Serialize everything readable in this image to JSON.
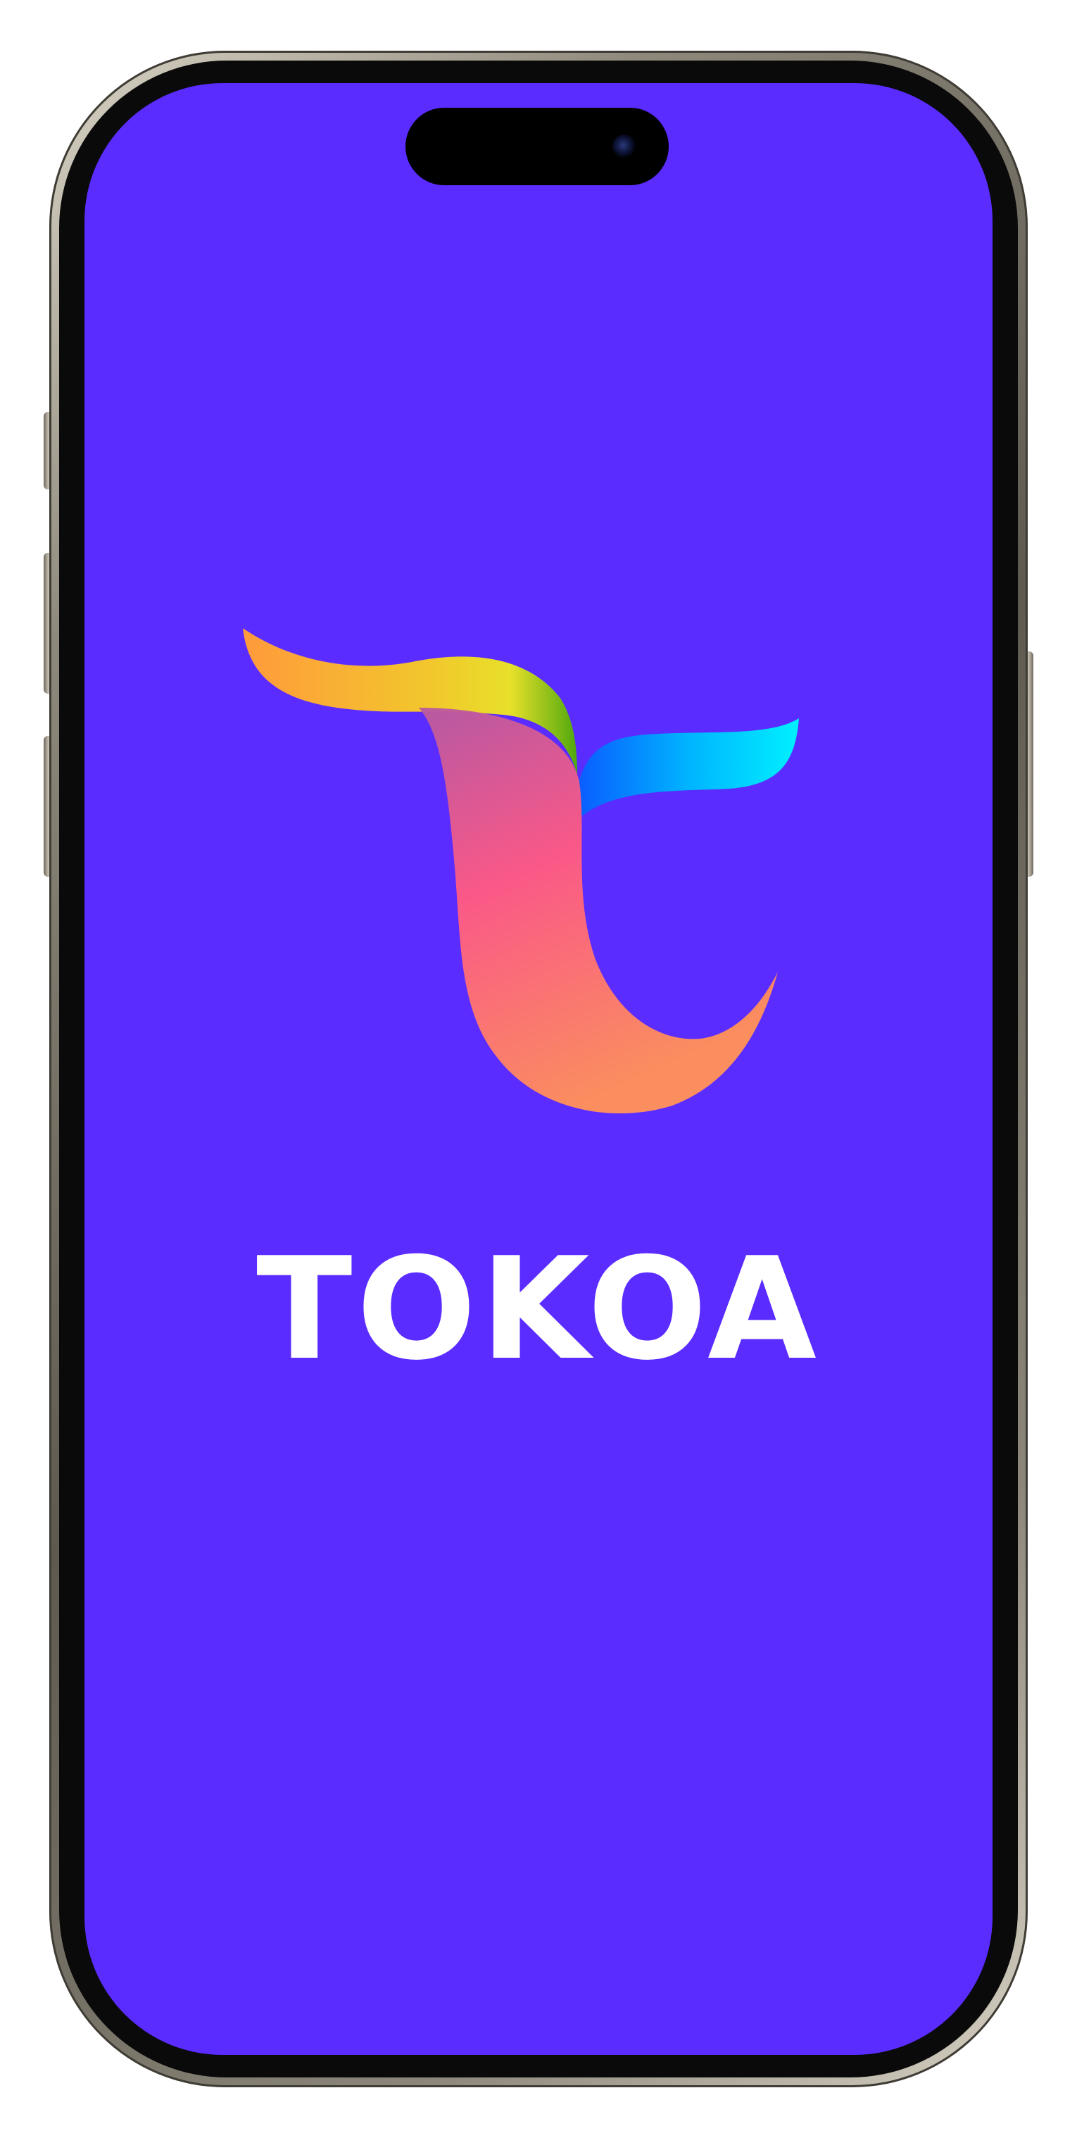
{
  "app": {
    "brand_name": "TOKOA",
    "screen": "splash"
  },
  "colors": {
    "background": "#5a2cff",
    "brand_text": "#ffffff",
    "logo_gradient_top": [
      "#ff9a3c",
      "#f2d82a",
      "#5bb80e"
    ],
    "logo_gradient_right": [
      "#0a6cff",
      "#00d8ff",
      "#00f0ff"
    ],
    "logo_gradient_stem": [
      "#d05a9a",
      "#ff5f80",
      "#ff8f5a"
    ]
  },
  "icons": {
    "logo": "tokoa-t-ribbon-logo"
  }
}
